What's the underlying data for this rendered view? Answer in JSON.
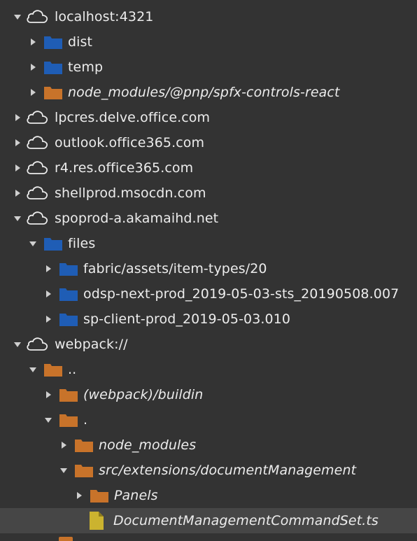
{
  "colors": {
    "background": "#333333",
    "selected_row": "#464646",
    "text": "#ececec",
    "arrow": "#cfcfcf",
    "folder_blue": "#1f5db5",
    "folder_orange": "#c8732a",
    "file_yellow": "#cbb32f"
  },
  "tree": [
    {
      "label": "localhost:4321",
      "icon": "cloud-icon",
      "expanded": true,
      "italic": false
    },
    {
      "label": "dist",
      "icon": "folder-blue-icon",
      "expanded": false,
      "italic": false
    },
    {
      "label": "temp",
      "icon": "folder-blue-icon",
      "expanded": false,
      "italic": false
    },
    {
      "label": "node_modules/@pnp/spfx-controls-react",
      "icon": "folder-orange-icon",
      "expanded": false,
      "italic": true
    },
    {
      "label": "lpcres.delve.office.com",
      "icon": "cloud-icon",
      "expanded": false,
      "italic": false
    },
    {
      "label": "outlook.office365.com",
      "icon": "cloud-icon",
      "expanded": false,
      "italic": false
    },
    {
      "label": "r4.res.office365.com",
      "icon": "cloud-icon",
      "expanded": false,
      "italic": false
    },
    {
      "label": "shellprod.msocdn.com",
      "icon": "cloud-icon",
      "expanded": false,
      "italic": false
    },
    {
      "label": "spoprod-a.akamaihd.net",
      "icon": "cloud-icon",
      "expanded": true,
      "italic": false
    },
    {
      "label": "files",
      "icon": "folder-blue-icon",
      "expanded": true,
      "italic": false
    },
    {
      "label": "fabric/assets/item-types/20",
      "icon": "folder-blue-icon",
      "expanded": false,
      "italic": false
    },
    {
      "label": "odsp-next-prod_2019-05-03-sts_20190508.007",
      "icon": "folder-blue-icon",
      "expanded": false,
      "italic": false
    },
    {
      "label": "sp-client-prod_2019-05-03.010",
      "icon": "folder-blue-icon",
      "expanded": false,
      "italic": false
    },
    {
      "label": "webpack://",
      "icon": "cloud-icon",
      "expanded": true,
      "italic": false
    },
    {
      "label": "..",
      "icon": "folder-orange-icon",
      "expanded": true,
      "italic": false
    },
    {
      "label": "(webpack)/buildin",
      "icon": "folder-orange-icon",
      "expanded": false,
      "italic": true
    },
    {
      "label": ".",
      "icon": "folder-orange-icon",
      "expanded": true,
      "italic": false
    },
    {
      "label": "node_modules",
      "icon": "folder-orange-icon",
      "expanded": false,
      "italic": true
    },
    {
      "label": "src/extensions/documentManagement",
      "icon": "folder-orange-icon",
      "expanded": true,
      "italic": true
    },
    {
      "label": "Panels",
      "icon": "folder-orange-icon",
      "expanded": false,
      "italic": true
    },
    {
      "label": "DocumentManagementCommandSet.ts",
      "icon": "file-yellow-icon",
      "expanded": null,
      "italic": true,
      "selected": true
    }
  ]
}
